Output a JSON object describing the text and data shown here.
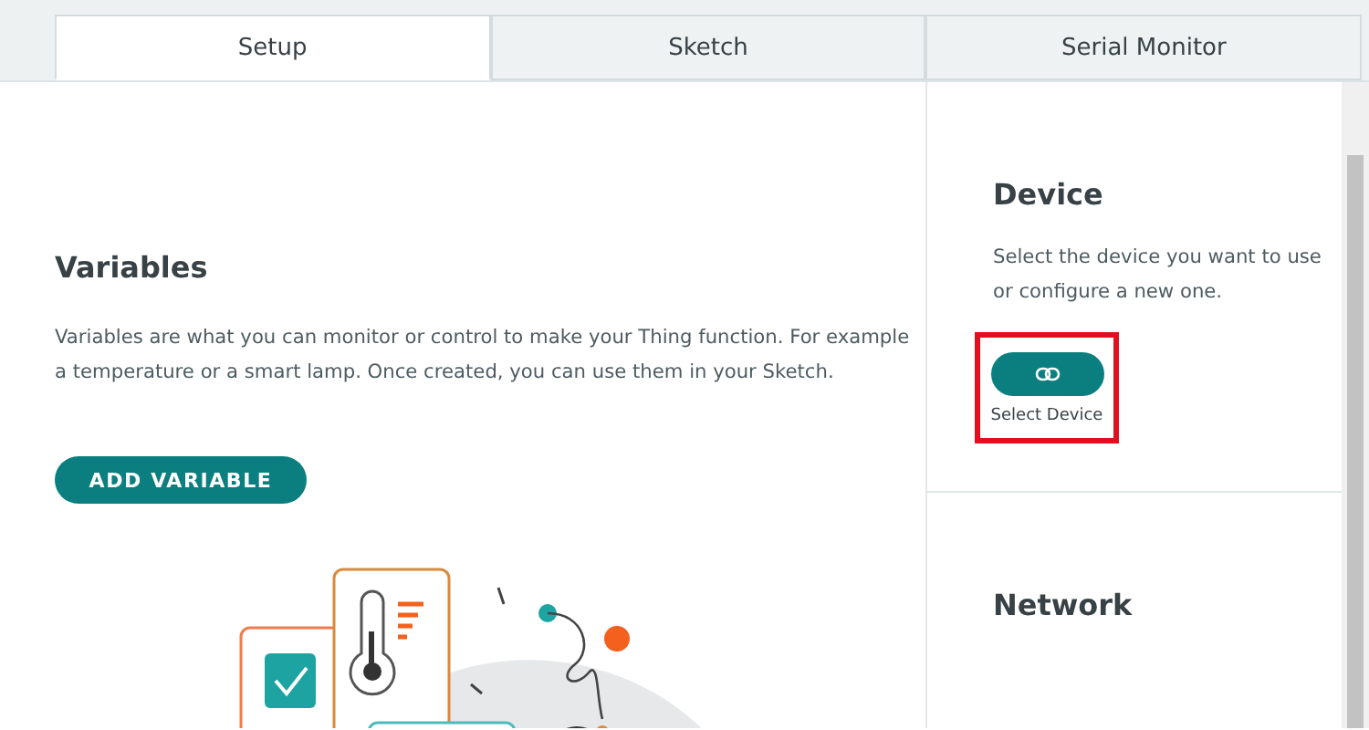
{
  "tabs": [
    {
      "label": "Setup",
      "selected": true
    },
    {
      "label": "Sketch",
      "selected": false
    },
    {
      "label": "Serial Monitor",
      "selected": false
    }
  ],
  "variables": {
    "title": "Variables",
    "description": "Variables are what you can monitor or control to make your Thing function. For example a temperature or a smart lamp. Once created, you can use them in your Sketch.",
    "button": "ADD VARIABLE"
  },
  "device": {
    "title": "Device",
    "description": "Select the device you want to use or configure a new one.",
    "button_label": "Select Device"
  },
  "network": {
    "title": "Network"
  }
}
